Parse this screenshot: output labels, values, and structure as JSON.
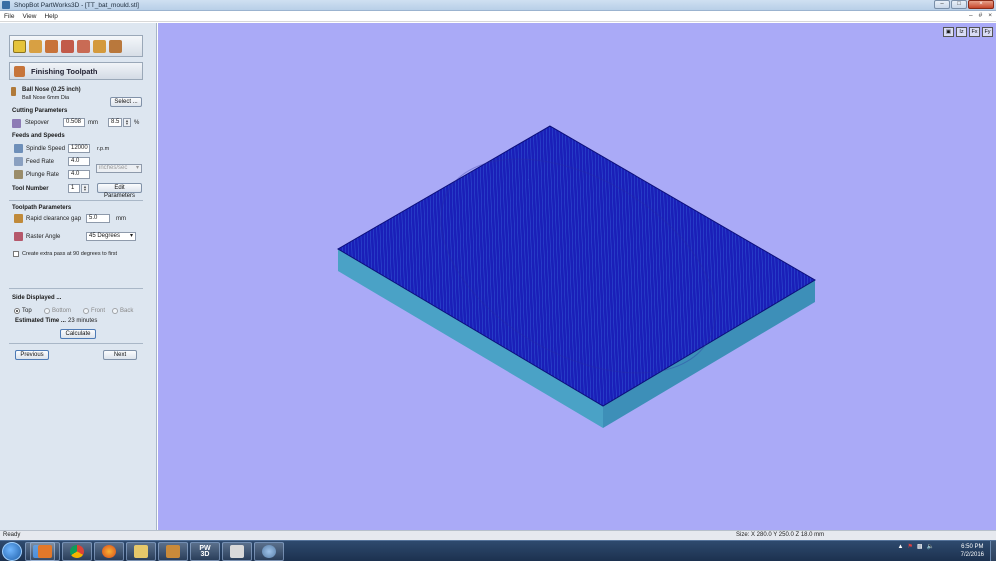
{
  "window": {
    "title": "ShopBot PartWorks3D - [TT_bat_mould.stl]"
  },
  "menu": {
    "items": [
      "File",
      "View",
      "Help"
    ],
    "mdi_controls": [
      "–",
      "#",
      "×"
    ]
  },
  "panel": {
    "title": "Finishing Toolpath",
    "tool": {
      "heading": "Ball Nose (0.25 inch)",
      "sub": "Ball Nose 6mm Dia",
      "select_label": "Select ..."
    },
    "cutting": {
      "heading": "Cutting Parameters",
      "stepover_label": "Stepover",
      "stepover_value": "0.508",
      "stepover_unit": "mm",
      "stepover_pct": "8.5",
      "pct_unit": "%"
    },
    "feeds": {
      "heading": "Feeds and Speeds",
      "spindle_label": "Spindle Speed",
      "spindle_value": "12000",
      "spindle_unit": "r.p.m",
      "feed_label": "Feed Rate",
      "feed_value": "4.0",
      "plunge_label": "Plunge Rate",
      "plunge_value": "4.0",
      "rate_unit": "inches/sec",
      "tool_number_label": "Tool Number",
      "tool_number_value": "1",
      "edit_label": "Edit Parameters"
    },
    "toolpath": {
      "heading": "Toolpath Parameters",
      "rapid_label": "Rapid clearance gap",
      "rapid_value": "5.0",
      "rapid_unit": "mm",
      "raster_label": "Raster Angle",
      "raster_value": "45 Degrees",
      "extra_pass_label": "Create extra pass at 90 degrees to first"
    },
    "side": {
      "heading": "Side Displayed ...",
      "options": [
        "Top",
        "Bottom",
        "Front",
        "Back"
      ],
      "selected": "Top",
      "estimated_label": "Estimated Time ...",
      "estimated_value": "23 minutes",
      "calculate_label": "Calculate"
    },
    "nav": {
      "previous_label": "Previous",
      "next_label": "Next"
    }
  },
  "viewport": {
    "view_buttons": [
      "▣",
      "Iz",
      "Fx",
      "Fy"
    ]
  },
  "status": {
    "left": "Ready",
    "right": "Size: X 280.0 Y 250.0 Z 18.0 mm"
  },
  "taskbar": {
    "pw_label": "PW\n3D",
    "clock_time": "6:50 PM",
    "clock_date": "7/2/2016",
    "apps": [
      "explorer-icon",
      "media-player-icon",
      "chrome-icon",
      "firefox-icon",
      "folder-icon",
      "photo-icon",
      "partworks-icon",
      "tool-icon",
      "settings-icon"
    ]
  },
  "colors": {
    "viewport_bg": "#aaaaf7",
    "block_top": "#1a1fb8",
    "block_side": "#4a9ec8",
    "panel_bg": "#dde6f0"
  }
}
